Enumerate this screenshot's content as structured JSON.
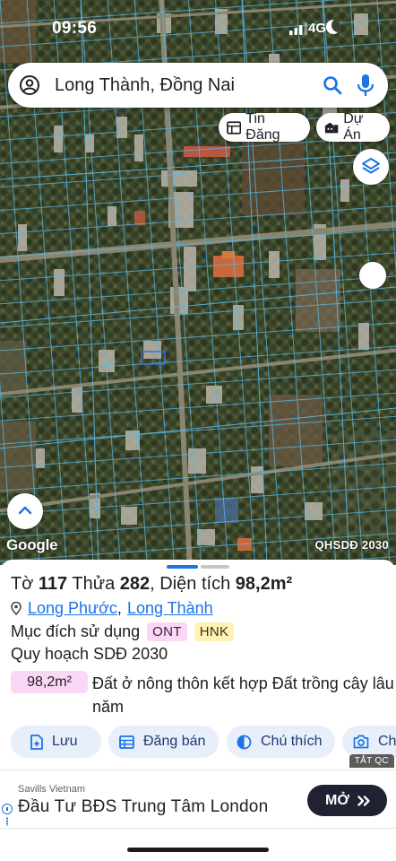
{
  "status_bar": {
    "time": "09:56",
    "network": "4G"
  },
  "search": {
    "value": "Long Thành, Đồng Nai"
  },
  "chips": {
    "listing": "Tin Đăng",
    "project": "Dự Án"
  },
  "map": {
    "attribution": "Google",
    "layer_badge": "QHSDĐ 2030"
  },
  "parcel": {
    "sheet_label": "Tờ",
    "sheet_no": "117",
    "plot_label": "Thửa",
    "plot_no": "282",
    "area_label": ", Diện tích",
    "area_value": "98,2m²",
    "ward": "Long Phước",
    "district": "Long Thành",
    "purpose_label": "Mục đích sử dụng",
    "purpose_codes": [
      "ONT",
      "HNK"
    ],
    "plan_label": "Quy hoạch SDĐ 2030",
    "plan_area": "98,2m²",
    "plan_desc": "Đất ở nông thôn kết hợp Đất trồng cây lâu năm"
  },
  "actions": {
    "save": "Lưu",
    "post": "Đăng bán",
    "legend": "Chú thích",
    "capture": "Ch"
  },
  "ad": {
    "close_label": "TẮT QC",
    "brand": "Savills Vietnam",
    "title": "Đầu Tư BĐS Trung Tâm London",
    "cta": "MỞ"
  },
  "colors": {
    "accent": "#1a73e8",
    "ont_tag": "#fad7f5",
    "hnk_tag": "#fff2b6",
    "action_bg": "#e8effb",
    "parcel_lines": "#58b8e8"
  },
  "icons": {
    "status": [
      "signal-icon",
      "moon-icon"
    ],
    "search_bar": [
      "account-icon",
      "search-icon",
      "mic-icon"
    ],
    "chips": [
      "listing-icon",
      "building-icon"
    ],
    "map": [
      "layers-icon",
      "chevron-up-icon"
    ],
    "info": [
      "location-pin-icon"
    ],
    "actions": [
      "add-file-icon",
      "table-icon",
      "contrast-icon",
      "camera-icon"
    ],
    "ad": [
      "double-chevron-icon",
      "info-icon"
    ]
  }
}
